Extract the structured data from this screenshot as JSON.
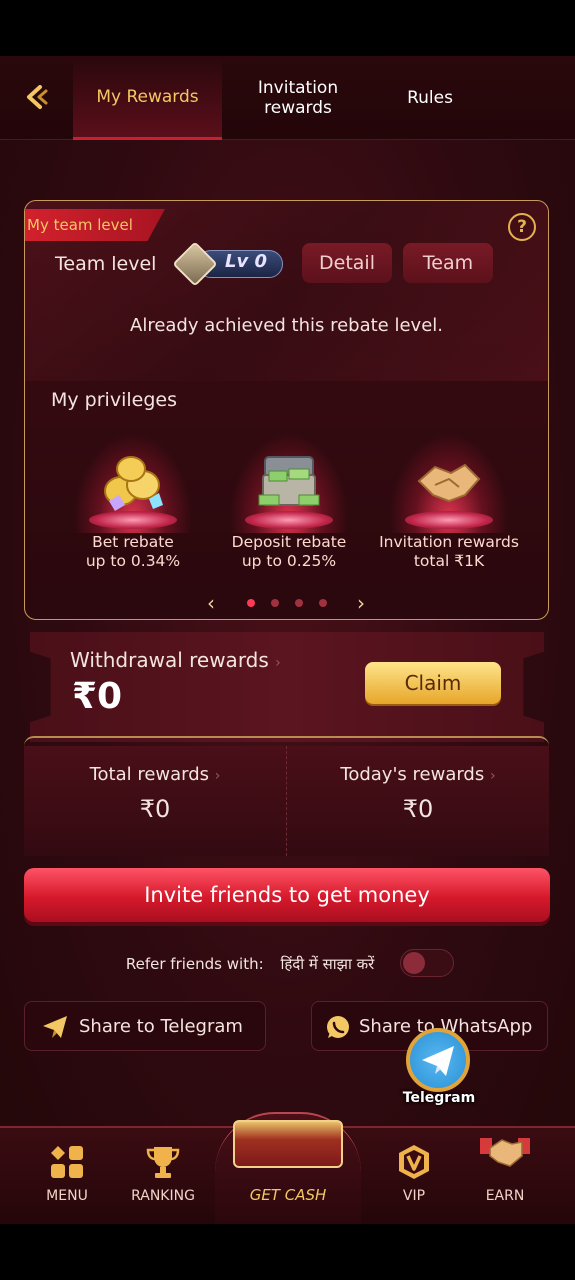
{
  "header": {
    "tabs": [
      {
        "label": "My Rewards",
        "active": true
      },
      {
        "label": "Invitation rewards",
        "active": false
      },
      {
        "label": "Rules",
        "active": false
      }
    ]
  },
  "team": {
    "ribbon": "My team level",
    "level_label": "Team level",
    "level_value": "Lv 0",
    "detail_button": "Detail",
    "team_button": "Team",
    "rebate_message": "Already achieved this rebate level.",
    "privileges_label": "My privileges",
    "privileges": [
      {
        "title": "Bet rebate",
        "subtitle": "up to 0.34%",
        "icon": "coins-gems-icon"
      },
      {
        "title": "Deposit rebate",
        "subtitle": "up to 0.25%",
        "icon": "cash-chest-icon"
      },
      {
        "title": "Invitation rewards",
        "subtitle": "total ₹1K",
        "icon": "handshake-icon"
      }
    ],
    "carousel_pages": 4,
    "carousel_active": 1
  },
  "withdrawal": {
    "label": "Withdrawal rewards",
    "value": "₹0",
    "claim_button": "Claim"
  },
  "rewards": {
    "total_label": "Total rewards",
    "total_value": "₹0",
    "today_label": "Today's rewards",
    "today_value": "₹0"
  },
  "invite_button": "Invite friends to get money",
  "refer": {
    "label": "Refer friends with:",
    "language": "हिंदी में साझा करें",
    "toggle_on": false
  },
  "share": {
    "telegram": "Share to Telegram",
    "whatsapp": "Share to WhatsApp"
  },
  "floating_telegram": "Telegram",
  "nav": {
    "menu": "MENU",
    "ranking": "RANKING",
    "get_cash": "GET CASH",
    "vip": "VIP",
    "earn": "EARN"
  },
  "colors": {
    "accent_gold": "#f3c763",
    "primary_red": "#d5192b",
    "background": "#2e0a10"
  }
}
